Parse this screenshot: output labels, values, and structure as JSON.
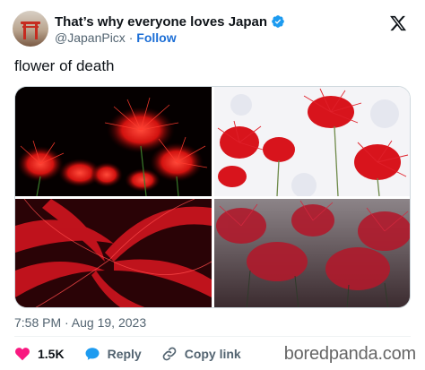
{
  "author": {
    "display_name": "That’s why everyone loves Japan",
    "handle": "@JapanPicx",
    "separator": " · ",
    "follow_label": "Follow"
  },
  "tweet": {
    "text": "flower of death",
    "timestamp": "7:58 PM · Aug 19, 2023"
  },
  "actions": {
    "like_count": "1.5K",
    "reply_label": "Reply",
    "copy_link_label": "Copy link"
  },
  "watermark": "boredpanda.com",
  "icons": {
    "verified": "verified-badge-icon",
    "x_logo": "x-logo-icon",
    "like": "heart-icon",
    "reply": "speech-bubble-icon",
    "copy_link": "link-icon"
  },
  "colors": {
    "verified": "#1d9bf0",
    "follow": "#1d6fd6",
    "like": "#f91880",
    "reply": "#1d9bf0",
    "text": "#0f1419",
    "secondary": "#536471"
  }
}
